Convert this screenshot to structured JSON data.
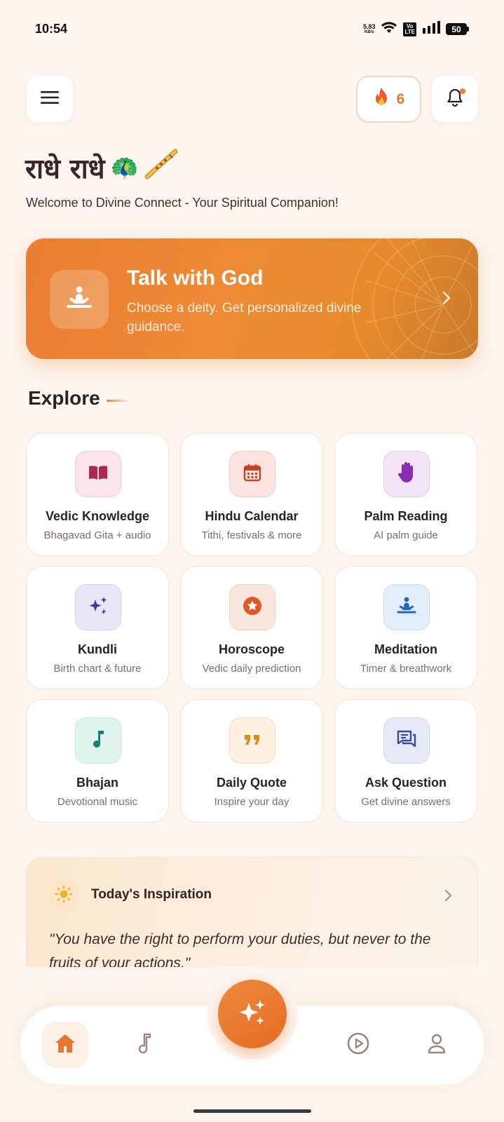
{
  "status_bar": {
    "time": "10:54",
    "net_speed_value": "5.83",
    "net_speed_unit": "KB/s",
    "volte_top": "Vo",
    "volte_bottom": "LTE",
    "battery": "50"
  },
  "header": {
    "streak_icon": "fire-icon",
    "streak_count": "6",
    "menu_icon": "hamburger-menu-icon",
    "bell_icon": "bell-icon"
  },
  "greeting": {
    "title": "राधे राधे",
    "emoji": "🦚",
    "subtitle": "Welcome to Divine Connect - Your Spiritual Companion!"
  },
  "hero": {
    "title": "Talk with God",
    "subtitle": "Choose a deity. Get personalized divine guidance.",
    "icon": "meditation-icon"
  },
  "explore": {
    "title": "Explore",
    "cards": [
      {
        "title": "Vedic Knowledge",
        "subtitle": "Bhagavad Gita + audio",
        "icon": "book-icon",
        "bg": "#fbe4ea",
        "color": "#b0264f"
      },
      {
        "title": "Hindu Calendar",
        "subtitle": "Tithi, festivals & more",
        "icon": "calendar-icon",
        "bg": "#fbe4df",
        "color": "#c44323"
      },
      {
        "title": "Palm Reading",
        "subtitle": "AI palm guide",
        "icon": "hand-icon",
        "bg": "#f2e3f7",
        "color": "#8a2bb0"
      },
      {
        "title": "Kundli",
        "subtitle": "Birth chart & future",
        "icon": "sparkles-icon",
        "bg": "#ebe6f7",
        "color": "#4a35a8"
      },
      {
        "title": "Horoscope",
        "subtitle": "Vedic daily prediction",
        "icon": "star-badge-icon",
        "bg": "#fbe6de",
        "color": "#e0572a"
      },
      {
        "title": "Meditation",
        "subtitle": "Timer & breathwork",
        "icon": "meditation-icon",
        "bg": "#e3eefb",
        "color": "#2565b8"
      },
      {
        "title": "Bhajan",
        "subtitle": "Devotional music",
        "icon": "music-note-icon",
        "bg": "#e0f3ef",
        "color": "#168072"
      },
      {
        "title": "Daily Quote",
        "subtitle": "Inspire your day",
        "icon": "quote-icon",
        "bg": "#fdf0de",
        "color": "#e08a1c"
      },
      {
        "title": "Ask Question",
        "subtitle": "Get divine answers",
        "icon": "chat-icon",
        "bg": "#e6eaf7",
        "color": "#3a4a9a"
      }
    ]
  },
  "inspiration": {
    "title": "Today's Inspiration",
    "quote": "\"You have the right to perform your duties, but never to the fruits of your actions.\"",
    "icon": "sun-icon"
  },
  "bottom_nav": {
    "items": [
      "home-icon",
      "music-icon",
      "ai-sparkle-icon",
      "play-icon",
      "profile-icon"
    ],
    "active": "home",
    "accent": "#e8772e"
  }
}
